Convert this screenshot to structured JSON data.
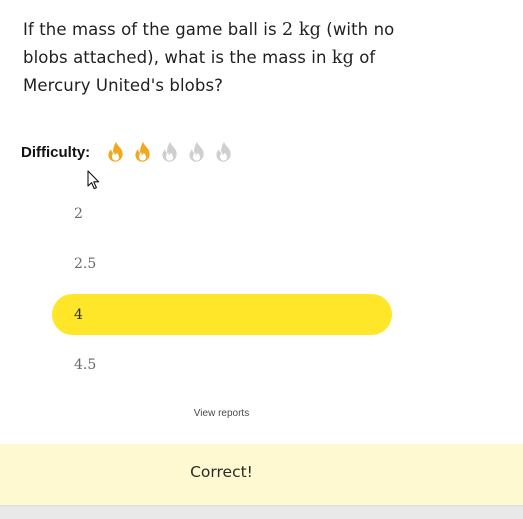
{
  "question": {
    "part1": "If the mass of the game ball is ",
    "mass_value": "2",
    "unit": "kg",
    "part2": " (with no blobs attached), what is the mass in ",
    "part3": " of Mercury United's blobs?"
  },
  "difficulty": {
    "label": "Difficulty:",
    "rating": 2,
    "max": 5,
    "icon": "flame-icon",
    "active_color": "#f2a81d",
    "inactive_color": "#cfcfcf"
  },
  "options": [
    {
      "label": "2",
      "selected": false
    },
    {
      "label": "2.5",
      "selected": false
    },
    {
      "label": "4",
      "selected": true
    },
    {
      "label": "4.5",
      "selected": false
    }
  ],
  "view_reports": "View reports",
  "feedback": {
    "text": "Correct!",
    "background": "#fff9d2"
  },
  "colors": {
    "selected_option": "#ffe629"
  }
}
